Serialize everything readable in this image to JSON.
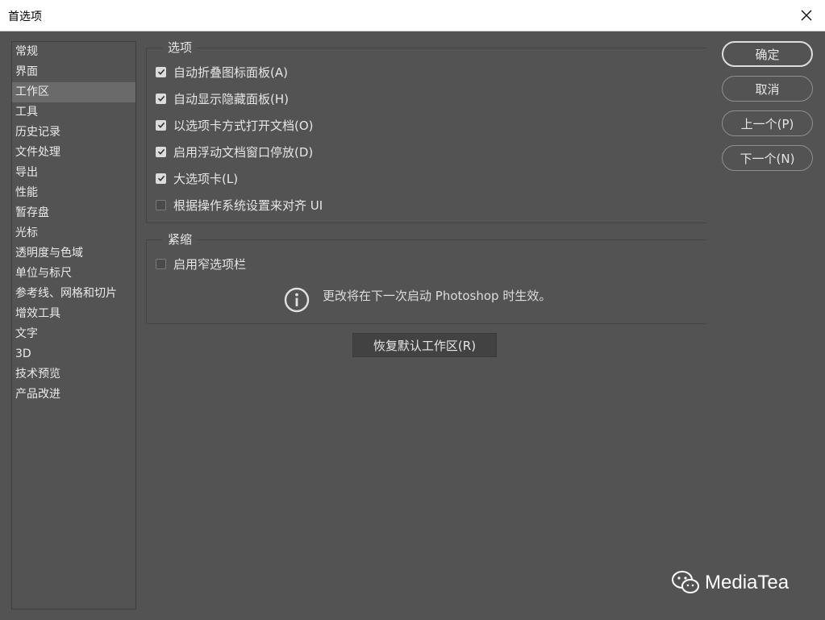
{
  "window": {
    "title": "首选项"
  },
  "sidebar": {
    "items": [
      {
        "label": "常规"
      },
      {
        "label": "界面"
      },
      {
        "label": "工作区"
      },
      {
        "label": "工具"
      },
      {
        "label": "历史记录"
      },
      {
        "label": "文件处理"
      },
      {
        "label": "导出"
      },
      {
        "label": "性能"
      },
      {
        "label": "暂存盘"
      },
      {
        "label": "光标"
      },
      {
        "label": "透明度与色域"
      },
      {
        "label": "单位与标尺"
      },
      {
        "label": "参考线、网格和切片"
      },
      {
        "label": "增效工具"
      },
      {
        "label": "文字"
      },
      {
        "label": "3D"
      },
      {
        "label": "技术预览"
      },
      {
        "label": "产品改进"
      }
    ],
    "selected_label": "工作区"
  },
  "options_group": {
    "title": "选项",
    "options": [
      {
        "label": "自动折叠图标面板(A)",
        "checked": true
      },
      {
        "label": "自动显示隐藏面板(H)",
        "checked": true
      },
      {
        "label": "以选项卡方式打开文档(O)",
        "checked": true
      },
      {
        "label": "启用浮动文档窗口停放(D)",
        "checked": true
      },
      {
        "label": "大选项卡(L)",
        "checked": true
      },
      {
        "label": "根据操作系统设置来对齐 UI",
        "checked": false
      }
    ]
  },
  "compact_group": {
    "title": "紧缩",
    "options": [
      {
        "label": "启用窄选项栏",
        "checked": false
      }
    ],
    "info_text": "更改将在下一次启动 Photoshop 时生效。"
  },
  "restore_button": {
    "label": "恢复默认工作区(R)"
  },
  "buttons": {
    "ok": "确定",
    "cancel": "取消",
    "prev": "上一个(P)",
    "next": "下一个(N)"
  },
  "watermark": {
    "text": "MediaTea"
  },
  "colors": {
    "background": "#535353",
    "selected_item": "#6a6a6a",
    "checkbox_checked": "#dcdcdc"
  }
}
